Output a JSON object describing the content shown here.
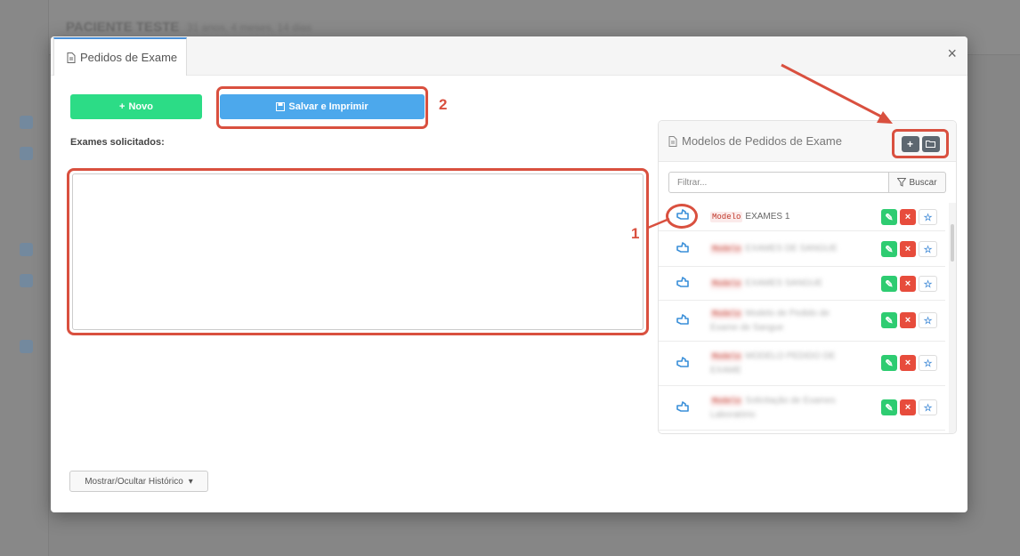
{
  "background": {
    "title": "PACIENTE TESTE",
    "subtitle": "31 anos, 4 meses, 14 dias"
  },
  "modal": {
    "tab_label": "Pedidos de Exame",
    "close_symbol": "×",
    "new_button": "Novo",
    "save_print_button": "Salvar e Imprimir",
    "exams_label": "Exames solicitados:",
    "history_toggle": "Mostrar/Ocultar Histórico"
  },
  "callouts": {
    "one": "1",
    "two": "2"
  },
  "templates_panel": {
    "title": "Modelos de Pedidos de Exame",
    "filter_placeholder": "Filtrar...",
    "search_button": "Buscar",
    "tag_label": "Modelo",
    "items": [
      {
        "name": "EXAMES 1"
      },
      {
        "name": "EXAMES DE SANGUE"
      },
      {
        "name": "EXAMES SANGUE"
      },
      {
        "name": "Modelo de Pedido de Exame de Sangue"
      },
      {
        "name": "MODELO PEDIDO DE EXAME"
      },
      {
        "name": "Solicitação de Exames Laboratório"
      }
    ]
  },
  "colors": {
    "novo": "#2cdc86",
    "salvar": "#4ca8ec",
    "highlight": "#d9503f",
    "edit": "#2ecc71",
    "delete": "#e74c3c"
  }
}
